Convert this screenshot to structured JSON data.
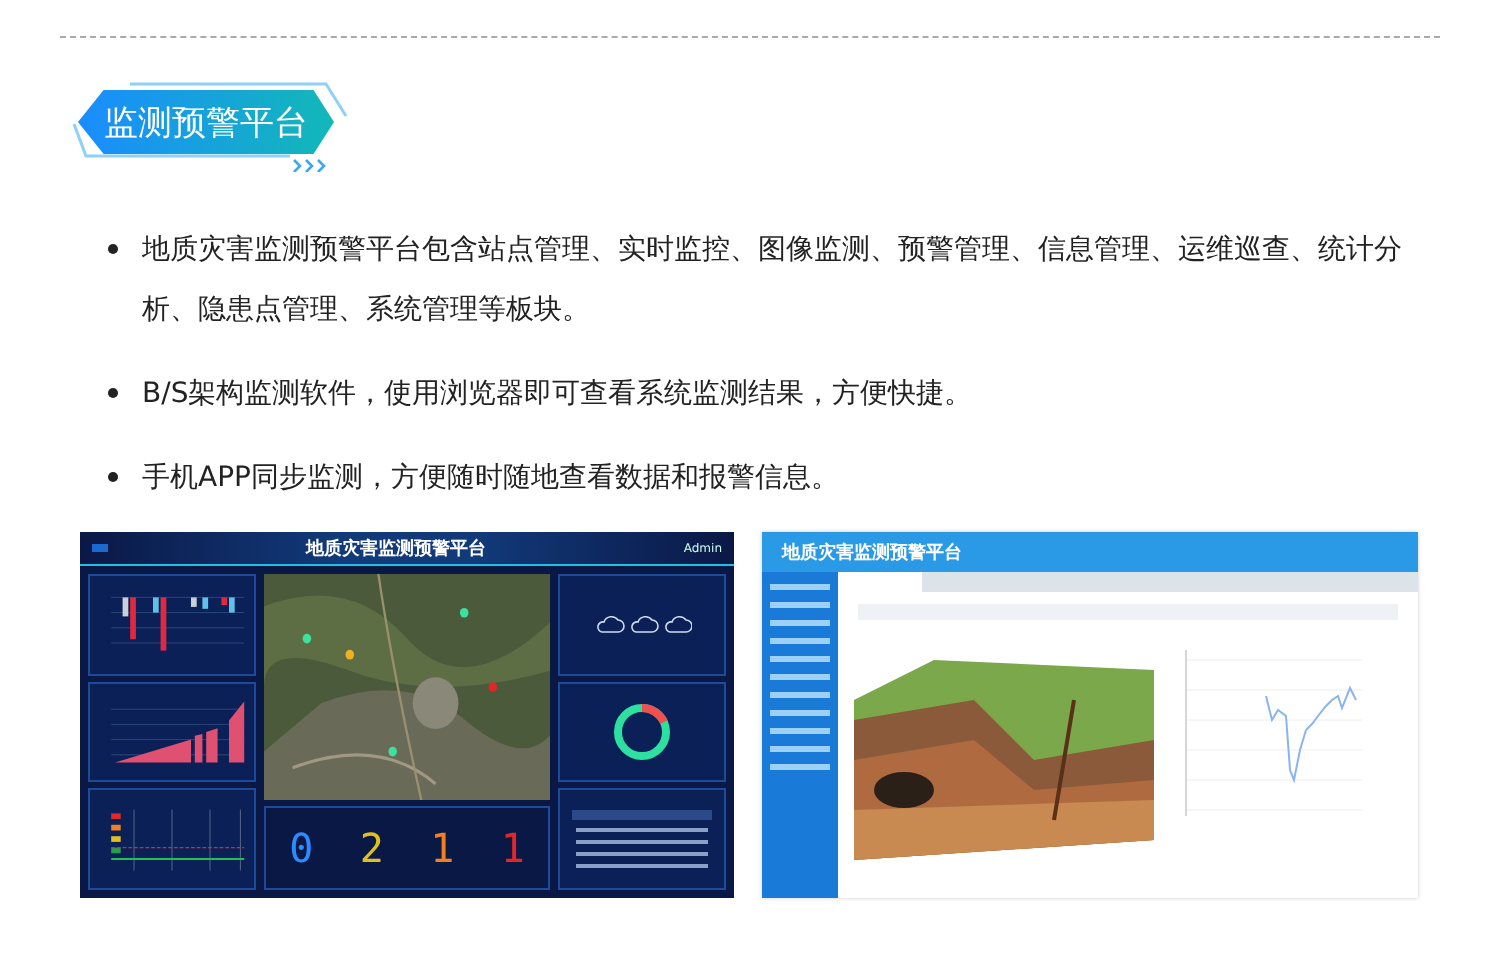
{
  "heading": "监测预警平台",
  "bullets": [
    "地质灾害监测预警平台包含站点管理、实时监控、图像监测、预警管理、信息管理、运维巡查、统计分析、隐患点管理、系统管理等板块。",
    "B/S架构监测软件，使用浏览器即可查看系统监测结果，方便快捷。",
    "手机APP同步监测，方便随时随地查看数据和报警信息。"
  ],
  "screens": [
    {
      "kind": "dashboard",
      "title": "地质灾害监测预警平台",
      "user": "Admin",
      "counts": [
        {
          "value": "0",
          "color": "#2a8cff"
        },
        {
          "value": "2",
          "color": "#e0c020"
        },
        {
          "value": "1",
          "color": "#f08020"
        },
        {
          "value": "1",
          "color": "#e02828"
        }
      ]
    },
    {
      "kind": "app",
      "title": "地质灾害监测预警平台"
    }
  ]
}
